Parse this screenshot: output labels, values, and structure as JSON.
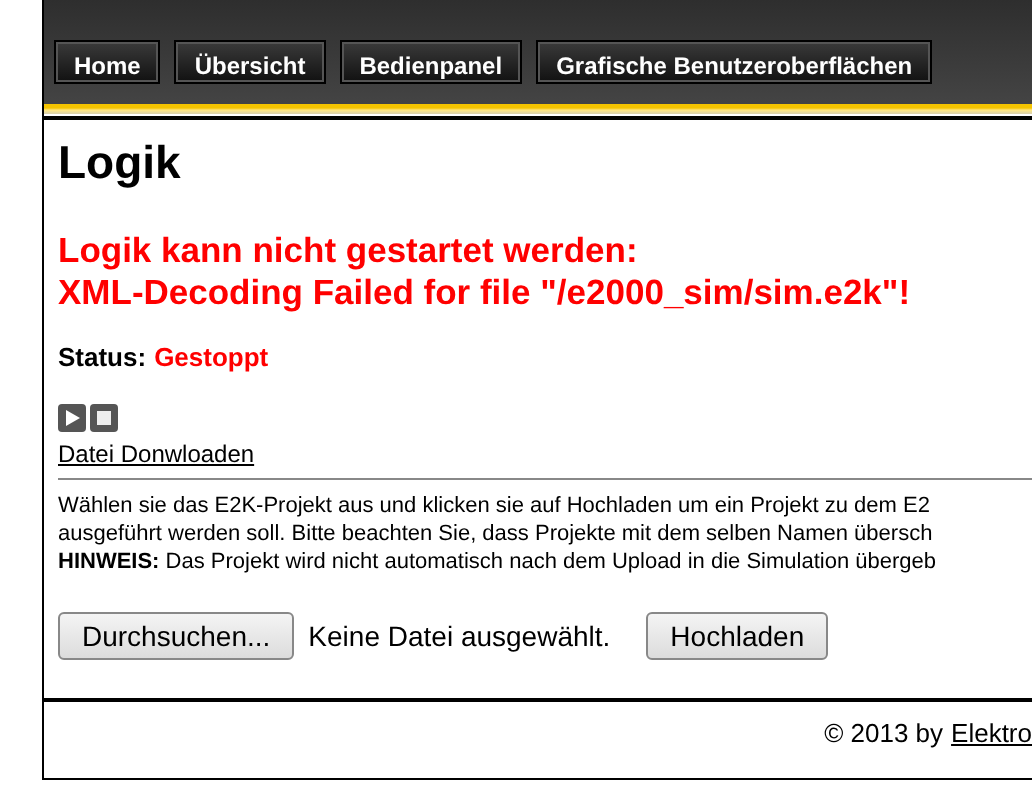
{
  "nav": [
    {
      "label": "Home"
    },
    {
      "label": "Übersicht"
    },
    {
      "label": "Bedienpanel"
    },
    {
      "label": "Grafische Benutzeroberflächen"
    }
  ],
  "page_title": "Logik",
  "error_lines": [
    "Logik kann nicht gestartet werden:",
    "XML-Decoding Failed for file \"/e2000_sim/sim.e2k\"!"
  ],
  "status": {
    "label": "Status:",
    "value": "Gestoppt"
  },
  "download_link": "Datei Donwloaden",
  "info_lines": [
    "Wählen sie das E2K-Projekt aus und klicken sie auf Hochladen um ein Projekt zu dem E2",
    "ausgeführt werden soll. Bitte beachten Sie, dass Projekte mit dem selben Namen übersch",
    "**HINWEIS:** Das Projekt wird nicht automatisch nach dem Upload in die Simulation übergeb"
  ],
  "upload": {
    "browse_button": "Durchsuchen...",
    "file_status": "Keine Datei ausgewählt.",
    "upload_button": "Hochladen"
  },
  "footer": {
    "text": "© 2013 by",
    "link": "Elektro"
  }
}
